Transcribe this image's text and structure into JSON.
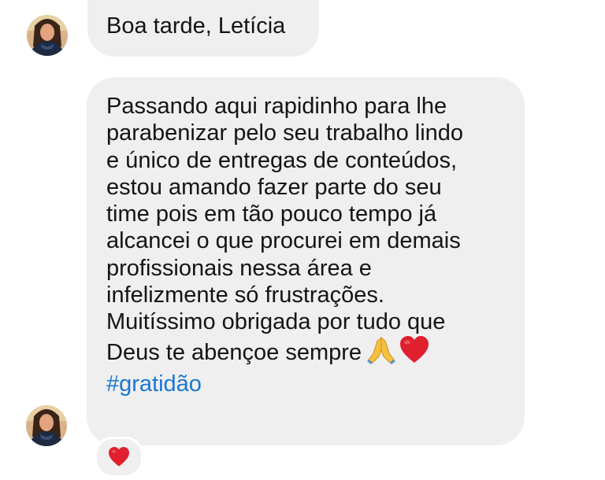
{
  "conversation": {
    "greeting_message": "Boa tarde, Letícia",
    "main_message": {
      "lines": [
        "Passando aqui rapidinho para lhe",
        "parabenizar pelo seu trabalho lindo",
        "e único de entregas de conteúdos,",
        "estou amando fazer parte do seu",
        "time pois em tão pouco tempo já",
        "alcancei o que procurei em demais",
        "profissionais nessa área e",
        "infelizmente só frustrações.",
        "Muitíssimo obrigada por tudo que",
        "Deus te abençoe sempre"
      ],
      "emojis": [
        "folded-hands-icon",
        "red-heart-icon"
      ],
      "hashtag": "#gratidão"
    },
    "reaction": "red-heart-icon"
  },
  "colors": {
    "bubble_background": "#efefef",
    "hashtag": "#1a77d2",
    "heart": "#e0202e",
    "text": "#141414"
  }
}
